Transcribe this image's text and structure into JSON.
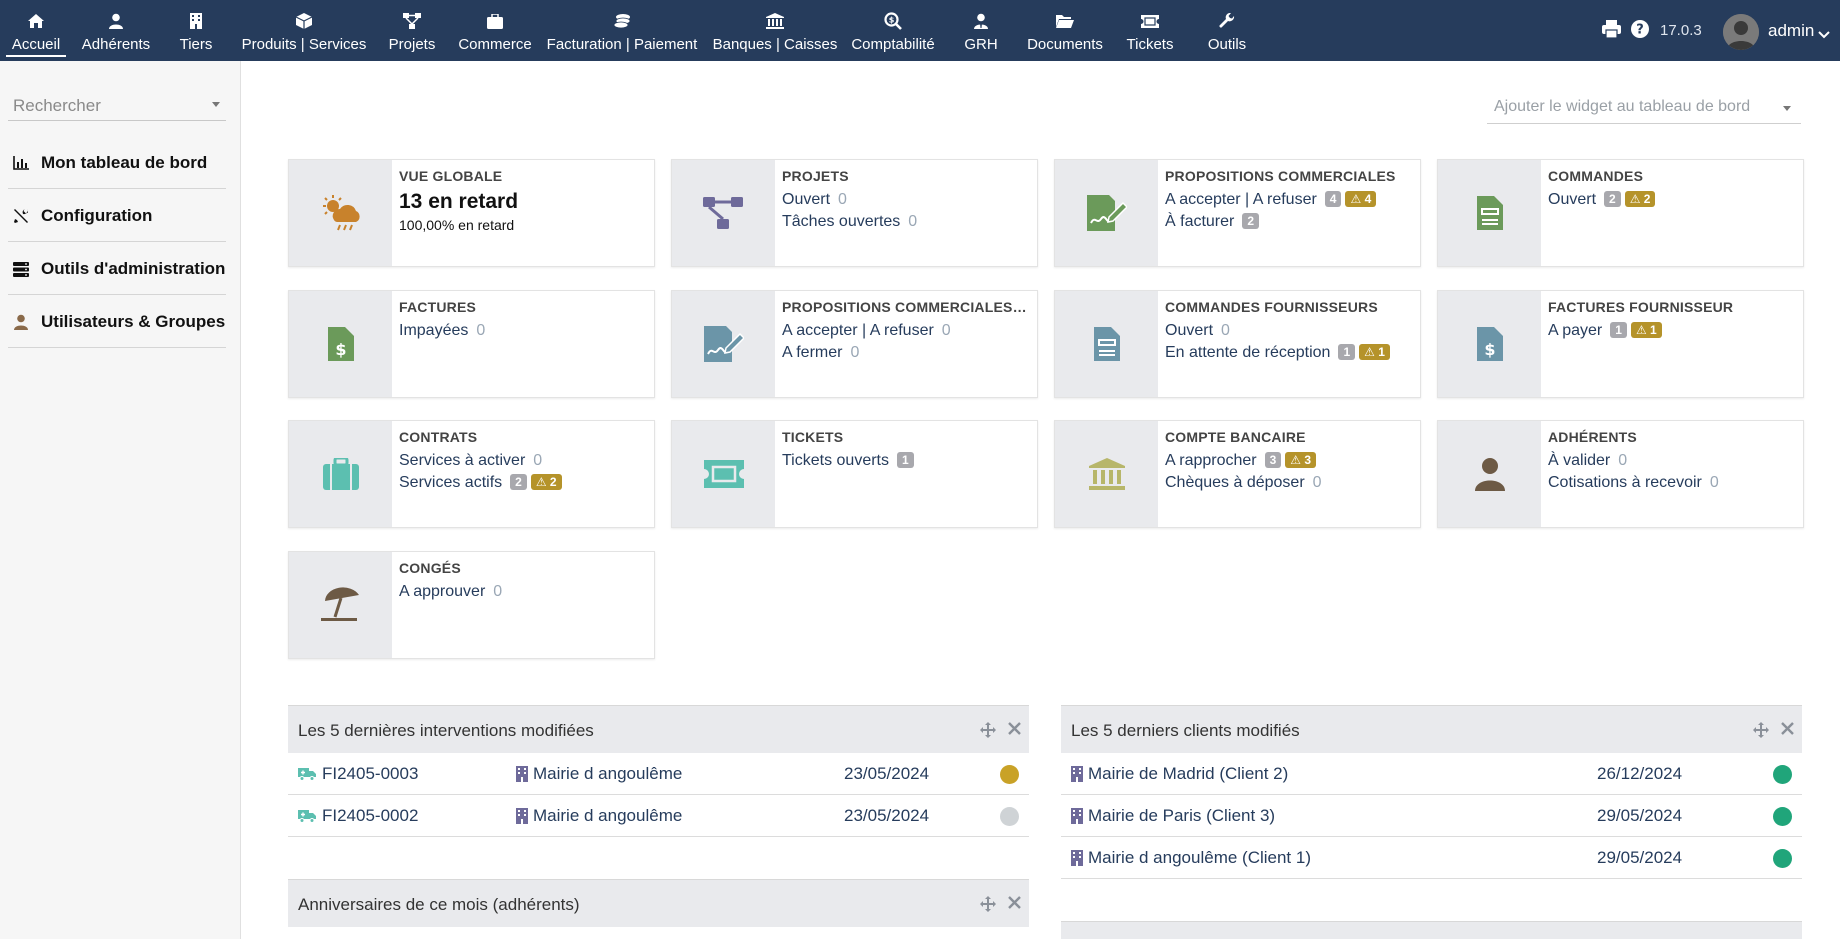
{
  "topbar": {
    "menu": [
      {
        "label": "Accueil",
        "icon": "home-icon"
      },
      {
        "label": "Adhérents",
        "icon": "user-icon"
      },
      {
        "label": "Tiers",
        "icon": "building-icon"
      },
      {
        "label": "Produits | Services",
        "icon": "cube-icon"
      },
      {
        "label": "Projets",
        "icon": "sitemap-icon"
      },
      {
        "label": "Commerce",
        "icon": "briefcase-icon"
      },
      {
        "label": "Facturation | Paiement",
        "icon": "coins-icon"
      },
      {
        "label": "Banques | Caisses",
        "icon": "bank-icon"
      },
      {
        "label": "Comptabilité",
        "icon": "search-dollar-icon"
      },
      {
        "label": "GRH",
        "icon": "user-tie-icon"
      },
      {
        "label": "Documents",
        "icon": "folder-open-icon"
      },
      {
        "label": "Tickets",
        "icon": "ticket-icon"
      },
      {
        "label": "Outils",
        "icon": "wrench-icon"
      }
    ],
    "version": "17.0.3",
    "user": "admin"
  },
  "sidebar": {
    "search_placeholder": "Rechercher",
    "items": [
      {
        "label": "Mon tableau de bord",
        "icon": "chart-bar-icon"
      },
      {
        "label": "Configuration",
        "icon": "tools-icon"
      },
      {
        "label": "Outils d'administration",
        "icon": "server-icon"
      },
      {
        "label": "Utilisateurs & Groupes",
        "icon": "user-icon"
      }
    ]
  },
  "widget_select": {
    "placeholder": "Ajouter le widget au tableau de bord"
  },
  "boxes": {
    "vue_globale": {
      "title": "VUE GLOBALE",
      "big": "13 en retard",
      "small": "100,00% en retard"
    },
    "projets": {
      "title": "PROJETS",
      "l1": "Ouvert",
      "l1_count": "0",
      "l2": "Tâches ouvertes",
      "l2_count": "0"
    },
    "propal_clients": {
      "title": "PROPOSITIONS COMMERCIALES",
      "l1": "A accepter | A refuser",
      "l1_count": "4",
      "l1_warn": "4",
      "l2": "À facturer",
      "l2_count": "2"
    },
    "commandes": {
      "title": "COMMANDES",
      "l1": "Ouvert",
      "l1_count": "2",
      "l1_warn": "2"
    },
    "factures": {
      "title": "FACTURES",
      "l1": "Impayées",
      "l1_count": "0"
    },
    "propal_fourn": {
      "title": "PROPOSITIONS COMMERCIALES FOURNISSEURS",
      "l1": "A accepter | A refuser",
      "l1_count": "0",
      "l2": "A fermer",
      "l2_count": "0"
    },
    "commandes_fourn": {
      "title": "COMMANDES FOURNISSEURS",
      "l1": "Ouvert",
      "l1_count": "0",
      "l2": "En attente de réception",
      "l2_count": "1",
      "l2_warn": "1"
    },
    "factures_fourn": {
      "title": "FACTURES FOURNISSEUR",
      "l1": "A payer",
      "l1_count": "1",
      "l1_warn": "1"
    },
    "contrats": {
      "title": "CONTRATS",
      "l1": "Services à activer",
      "l1_count": "0",
      "l2": "Services actifs",
      "l2_count": "2",
      "l2_warn": "2"
    },
    "tickets": {
      "title": "TICKETS",
      "l1": "Tickets ouverts",
      "l1_count": "1"
    },
    "compte": {
      "title": "COMPTE BANCAIRE",
      "l1": "A rapprocher",
      "l1_count": "3",
      "l1_warn": "3",
      "l2": "Chèques à déposer",
      "l2_count": "0"
    },
    "adherents": {
      "title": "ADHÉRENTS",
      "l1": "À valider",
      "l1_count": "0",
      "l2": "Cotisations à recevoir",
      "l2_count": "0"
    },
    "conges": {
      "title": "CONGÉS",
      "l1": "A approuver",
      "l1_count": "0"
    }
  },
  "panels": {
    "interventions": {
      "title": "Les 5 dernières interventions modifiées",
      "rows": [
        {
          "ref": "FI2405-0003",
          "client": "Mairie d angoulême",
          "date": "23/05/2024",
          "status_color": "#c9a227"
        },
        {
          "ref": "FI2405-0002",
          "client": "Mairie d angoulême",
          "date": "23/05/2024",
          "status_color": "#cfd3d6"
        }
      ]
    },
    "clients": {
      "title": "Les 5 derniers clients modifiés",
      "rows": [
        {
          "name": "Mairie de Madrid (Client 2)",
          "date": "26/12/2024",
          "status_color": "#20a57a"
        },
        {
          "name": "Mairie de Paris (Client 3)",
          "date": "29/05/2024",
          "status_color": "#20a57a"
        },
        {
          "name": "Mairie d angoulême (Client 1)",
          "date": "29/05/2024",
          "status_color": "#20a57a"
        }
      ]
    },
    "anniversaires": {
      "title": "Anniversaires de ce mois (adhérents)"
    }
  },
  "colors": {
    "topbar": "#263c5c",
    "link": "#263c5c",
    "warning": "#b5932a",
    "badge": "#a8a8ad"
  }
}
